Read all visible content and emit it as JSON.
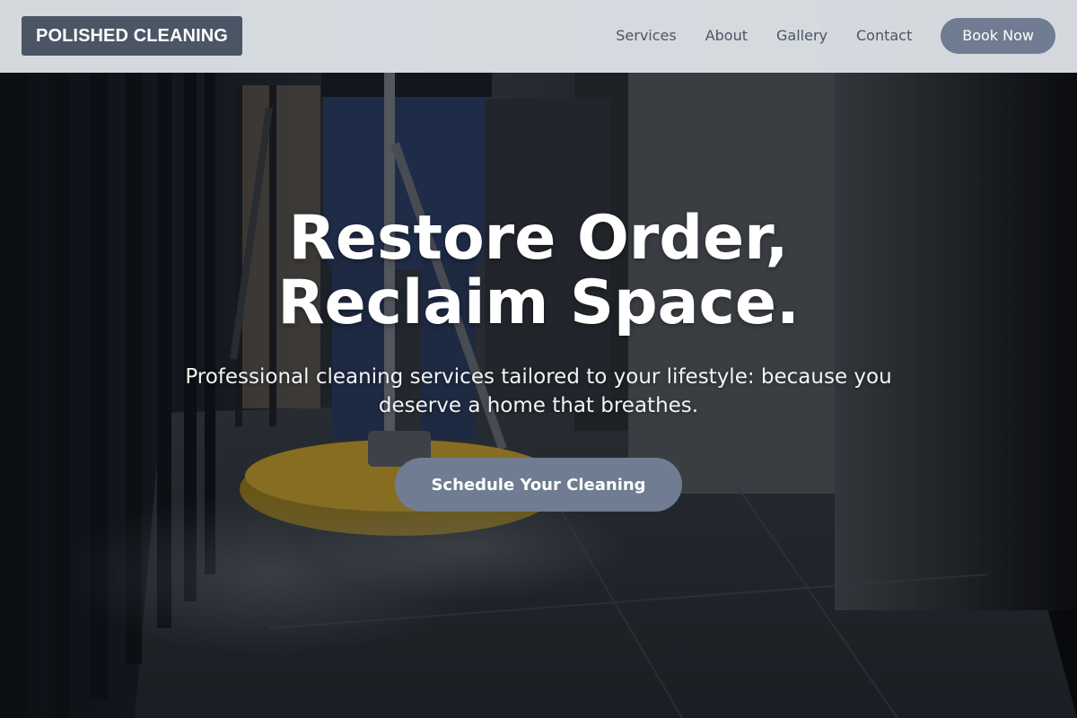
{
  "brand": {
    "logo_text": "POLISHED CLEANING"
  },
  "nav": {
    "links": [
      {
        "label": "Services"
      },
      {
        "label": "About"
      },
      {
        "label": "Gallery"
      },
      {
        "label": "Contact"
      }
    ],
    "cta_label": "Book Now"
  },
  "hero": {
    "title_line_1": "Restore Order,",
    "title_line_2": "Reclaim Space.",
    "subtitle": "Professional cleaning services tailored to your lifestyle: because you deserve a home that breathes.",
    "cta_label": "Schedule Your Cleaning",
    "background_image": "floor-cleaning-photo"
  },
  "colors": {
    "header_bg": "#e4e8ee",
    "logo_bg": "#4b5565",
    "nav_text": "#4a5566",
    "button_bg": "#6f7c91",
    "button_text": "#ffffff",
    "hero_text": "#ffffff"
  }
}
